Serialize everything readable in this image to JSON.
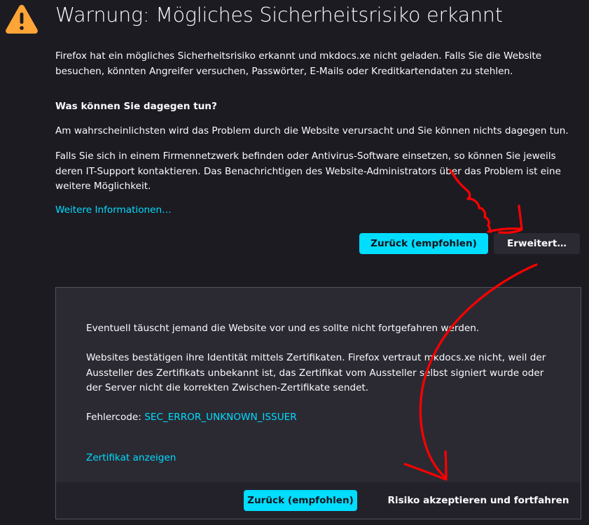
{
  "page": {
    "title": "Warnung: Mögliches Sicherheitsrisiko erkannt",
    "intro": "Firefox hat ein mögliches Sicherheitsrisiko erkannt und mkdocs.xe nicht geladen. Falls Sie die Website besuchen, könnten Angreifer versuchen, Passwörter, E-Mails oder Kreditkartendaten zu stehlen.",
    "subheading": "Was können Sie dagegen tun?",
    "paragraph1": "Am wahrscheinlichsten wird das Problem durch die Website verursacht und Sie können nichts dagegen tun.",
    "paragraph2": "Falls Sie sich in einem Firmennetzwerk befinden oder Antivirus-Software einsetzen, so können Sie jeweils deren IT-Support kontaktieren. Das Benachrichtigen des Website-Administrators über das Problem ist eine weitere Möglichkeit.",
    "more_info_link": "Weitere Informationen…"
  },
  "buttons": {
    "back_recommended": "Zurück (empfohlen)",
    "advanced": "Erweitert…"
  },
  "advanced": {
    "paragraph1": "Eventuell täuscht jemand die Website vor und es sollte nicht fortgefahren werden.",
    "paragraph2": "Websites bestätigen ihre Identität mittels Zertifikaten. Firefox vertraut mkdocs.xe nicht, weil der Aussteller des Zertifikats unbekannt ist, das Zertifikat vom Aussteller selbst signiert wurde oder der Server nicht die korrekten Zwischen-Zertifikate sendet.",
    "error_label": "Fehlercode:",
    "error_code": "SEC_ERROR_UNKNOWN_ISSUER",
    "view_certificate": "Zertifikat anzeigen",
    "back_recommended": "Zurück (empfohlen)",
    "accept_risk": "Risiko akzeptieren und fortfahren"
  },
  "icons": {
    "warning": "warning-triangle-icon"
  },
  "colors": {
    "background": "#1c1b22",
    "panel": "#2b2a33",
    "accent": "#00ddff",
    "warning": "#ffa436",
    "annotation": "#ff0000"
  }
}
